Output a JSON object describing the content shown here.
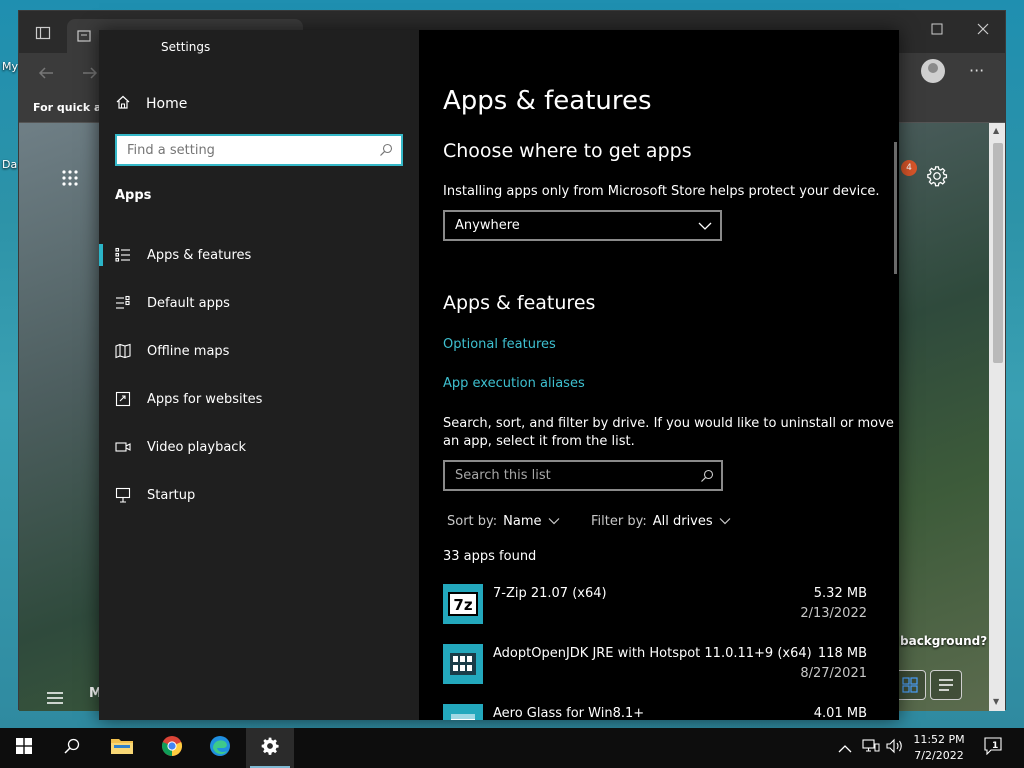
{
  "desktop": {
    "label_my": "My",
    "label_da": "Da"
  },
  "edge": {
    "favorites_text": "For quick ac",
    "bottom_label": "M",
    "notification_count": "4",
    "background_question": "background?"
  },
  "settings": {
    "window_title": "Settings",
    "home_label": "Home",
    "search_placeholder": "Find a setting",
    "section_title": "Apps",
    "nav": [
      {
        "label": "Apps & features",
        "icon": "apps-features-icon",
        "selected": true
      },
      {
        "label": "Default apps",
        "icon": "default-apps-icon"
      },
      {
        "label": "Offline maps",
        "icon": "offline-maps-icon"
      },
      {
        "label": "Apps for websites",
        "icon": "apps-for-websites-icon"
      },
      {
        "label": "Video playback",
        "icon": "video-playback-icon"
      },
      {
        "label": "Startup",
        "icon": "startup-icon"
      }
    ],
    "page_title": "Apps & features",
    "choose_heading": "Choose where to get apps",
    "choose_desc": "Installing apps only from Microsoft Store helps protect your device.",
    "source_dropdown": "Anywhere",
    "section_heading": "Apps & features",
    "optional_features": "Optional features",
    "execution_aliases": "App execution aliases",
    "search_desc_1": "Search, sort, and filter by drive. If you would like to uninstall or move",
    "search_desc_2": "an app, select it from the list.",
    "list_search_placeholder": "Search this list",
    "sort_label": "Sort by:",
    "sort_value": "Name",
    "filter_label": "Filter by:",
    "filter_value": "All drives",
    "count_text": "33 apps found",
    "apps": [
      {
        "name": "7-Zip 21.07 (x64)",
        "size": "5.32 MB",
        "date": "2/13/2022",
        "icon": "7zip-icon"
      },
      {
        "name": "AdoptOpenJDK JRE with Hotspot 11.0.11+9 (x64)",
        "size": "118 MB",
        "date": "8/27/2021",
        "icon": "grid-app-icon"
      },
      {
        "name": "Aero Glass for Win8.1+",
        "size": "4.01 MB",
        "date": "",
        "icon": "window-app-icon"
      }
    ],
    "accent_color": "#2bb5c8"
  },
  "taskbar": {
    "time": "11:52 PM",
    "date": "7/2/2022",
    "notifications": "1"
  }
}
